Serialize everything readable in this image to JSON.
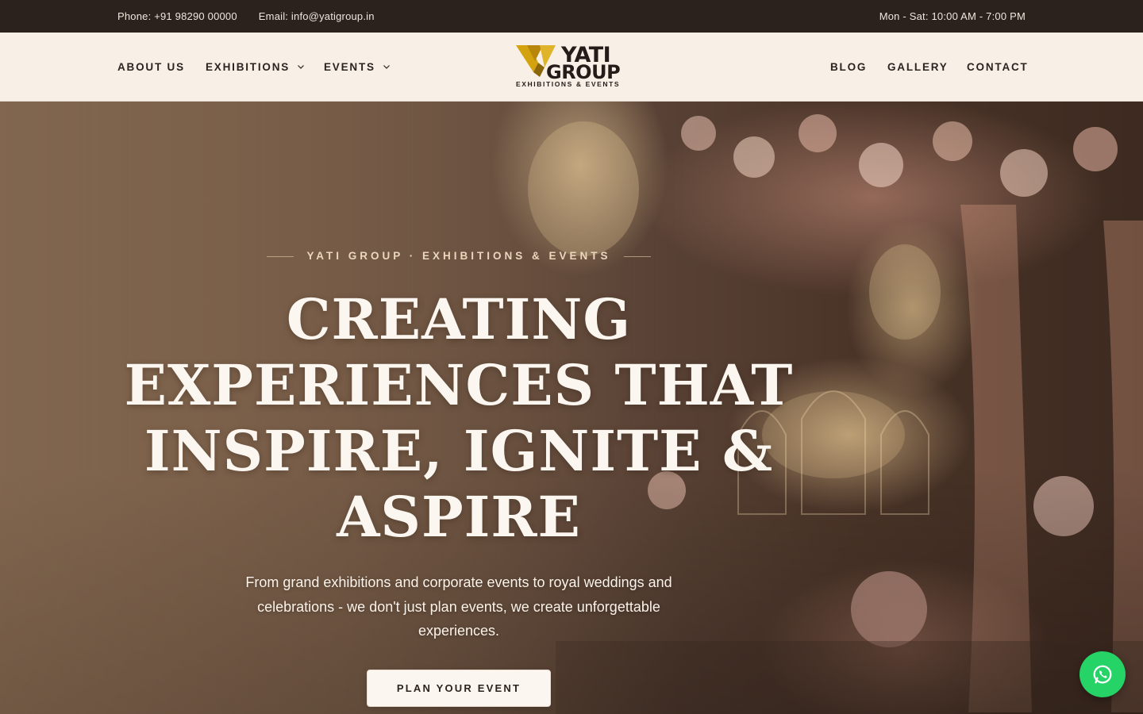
{
  "topbar": {
    "phone": "Phone: +91 98290 00000",
    "email": "Email: info@yatigroup.in",
    "hours": "Mon - Sat: 10:00 AM - 7:00 PM"
  },
  "nav": {
    "left": [
      {
        "label": "ABOUT US",
        "has_dropdown": false
      },
      {
        "label": "EXHIBITIONS",
        "has_dropdown": true
      },
      {
        "label": "EVENTS",
        "has_dropdown": true
      }
    ],
    "right": [
      {
        "label": "BLOG"
      },
      {
        "label": "GALLERY"
      },
      {
        "label": "CONTACT"
      }
    ]
  },
  "logo": {
    "word1": "YATI",
    "word2": "GROUP",
    "subtitle": "EXHIBITIONS & EVENTS",
    "colors": {
      "gold": "#d4a20f",
      "dark": "#231c18"
    }
  },
  "hero": {
    "eyebrow": "YATI GROUP · EXHIBITIONS & EVENTS",
    "headline": "CREATING EXPERIENCES THAT INSPIRE, IGNITE & ASPIRE",
    "subtitle": "From grand exhibitions and corporate events to royal weddings and celebrations - we don't just plan events, we create unforgettable experiences.",
    "cta_label": "PLAN YOUR EVENT"
  },
  "floating": {
    "whatsapp_icon": "whatsapp-icon",
    "color": "#25d366"
  },
  "colors": {
    "topbar_bg": "#2b221e",
    "nav_bg": "#f8f0e7",
    "text_dark": "#2b231f"
  }
}
